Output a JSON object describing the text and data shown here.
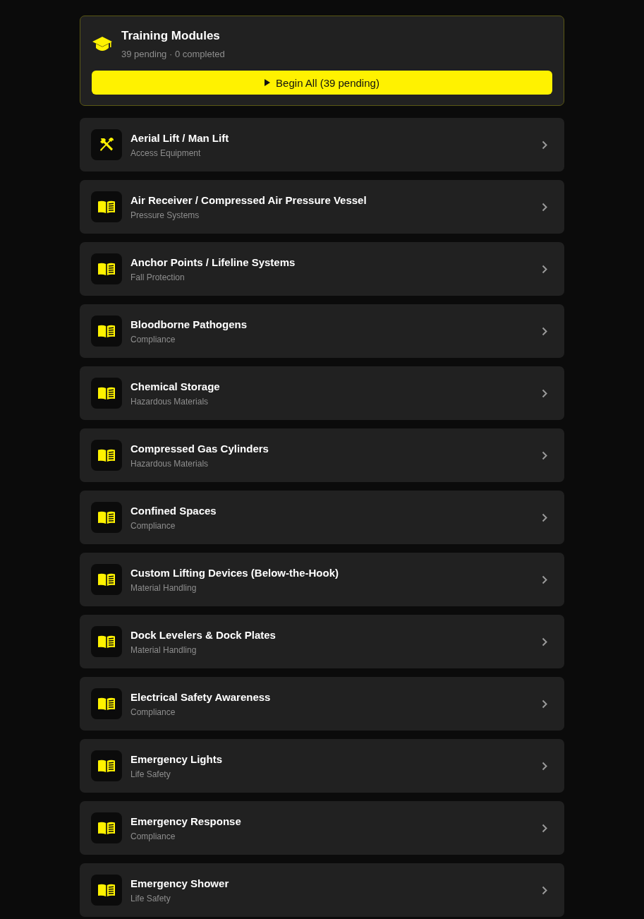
{
  "header": {
    "title": "Training Modules",
    "summary": "39 pending · 0 completed",
    "action": "Begin All (39 pending)"
  },
  "modules": [
    {
      "kind": "equipment",
      "title": "Aerial Lift / Man Lift",
      "category": "Access Equipment"
    },
    {
      "kind": "document",
      "title": "Air Receiver / Compressed Air Pressure Vessel",
      "category": "Pressure Systems"
    },
    {
      "kind": "document",
      "title": "Anchor Points / Lifeline Systems",
      "category": "Fall Protection"
    },
    {
      "kind": "document",
      "title": "Bloodborne Pathogens",
      "category": "Compliance"
    },
    {
      "kind": "document",
      "title": "Chemical Storage",
      "category": "Hazardous Materials"
    },
    {
      "kind": "document",
      "title": "Compressed Gas Cylinders",
      "category": "Hazardous Materials"
    },
    {
      "kind": "document",
      "title": "Confined Spaces",
      "category": "Compliance"
    },
    {
      "kind": "document",
      "title": "Custom Lifting Devices (Below-the-Hook)",
      "category": "Material Handling"
    },
    {
      "kind": "document",
      "title": "Dock Levelers & Dock Plates",
      "category": "Material Handling"
    },
    {
      "kind": "document",
      "title": "Electrical Safety Awareness",
      "category": "Compliance"
    },
    {
      "kind": "document",
      "title": "Emergency Lights",
      "category": "Life Safety"
    },
    {
      "kind": "document",
      "title": "Emergency Response",
      "category": "Compliance"
    },
    {
      "kind": "document",
      "title": "Emergency Shower",
      "category": "Life Safety"
    }
  ]
}
